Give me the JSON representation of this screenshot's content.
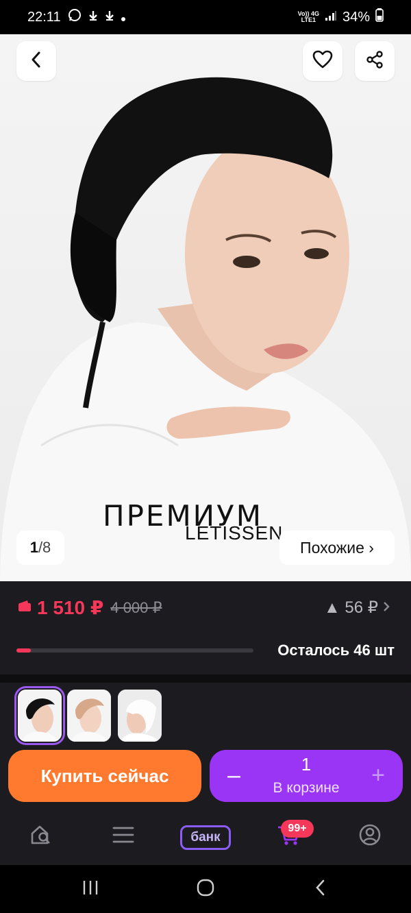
{
  "status": {
    "time": "22:11",
    "net_top": "Vo)) 4G",
    "net_bottom": "LTE1",
    "battery": "34%"
  },
  "hero": {
    "brand_title": "ПРЕМИУМ",
    "brand_sub": "LETISSEN",
    "counter_current": "1",
    "counter_total": "/8",
    "similar_label": "Похожие ›"
  },
  "price": {
    "current": "1 510 ₽",
    "old": "4 000 ₽",
    "drop": "▲ 56 ₽",
    "stock_text": "Осталось 46 шт",
    "stock_fraction": 0.06
  },
  "actions": {
    "buy_label": "Купить сейчас",
    "cart_qty": "1",
    "cart_label": "В корзине",
    "minus": "–",
    "plus": "+"
  },
  "nav": {
    "bank_label": "банк",
    "cart_badge": "99+"
  },
  "colors": {
    "accent_purple": "#9b35f5",
    "buy_orange": "#ff7a2e",
    "price_red": "#f5385a"
  }
}
